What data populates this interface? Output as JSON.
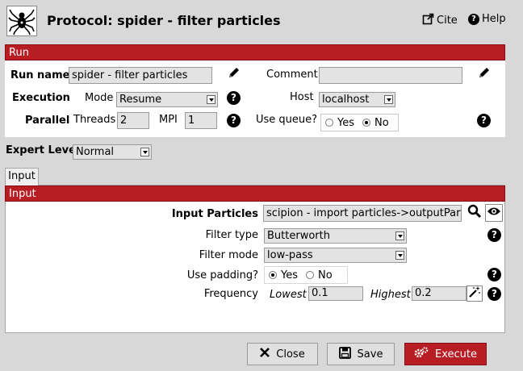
{
  "header": {
    "title": "Protocol: spider - filter particles",
    "cite_label": "Cite",
    "help_label": "Help"
  },
  "run": {
    "section_title": "Run",
    "run_name_label": "Run name",
    "run_name_value": "spider - filter particles",
    "comment_label": "Comment",
    "comment_value": "",
    "execution_label": "Execution",
    "mode_label": "Mode",
    "mode_value": "Resume",
    "host_label": "Host",
    "host_value": "localhost",
    "parallel_label": "Parallel",
    "threads_label": "Threads",
    "threads_value": "2",
    "mpi_label": "MPI",
    "mpi_value": "1",
    "use_queue_label": "Use queue?",
    "queue_yes": "Yes",
    "queue_no": "No",
    "queue_selected": "No"
  },
  "expert": {
    "label": "Expert Level",
    "value": "Normal"
  },
  "tabs": [
    {
      "label": "Input"
    }
  ],
  "input": {
    "section_title": "Input",
    "input_particles_label": "Input Particles",
    "input_particles_value": "scipion - import particles->outputParticles",
    "filter_type_label": "Filter type",
    "filter_type_value": "Butterworth",
    "filter_mode_label": "Filter mode",
    "filter_mode_value": "low-pass",
    "use_padding_label": "Use padding?",
    "padding_yes": "Yes",
    "padding_no": "No",
    "padding_selected": "Yes",
    "frequency_label": "Frequency",
    "lowest_label": "Lowest",
    "lowest_value": "0.1",
    "highest_label": "Highest",
    "highest_value": "0.2"
  },
  "footer": {
    "close_label": "Close",
    "save_label": "Save",
    "execute_label": "Execute"
  },
  "colors": {
    "accent": "#b81d23",
    "background": "#d8d8d8",
    "field": "#e3e3e3"
  },
  "icons": [
    "spider-logo-icon",
    "external-link-icon",
    "question-icon",
    "pencil-icon",
    "search-icon",
    "eye-icon",
    "magic-wand-icon",
    "close-x-icon",
    "save-disk-icon",
    "gears-icon"
  ]
}
